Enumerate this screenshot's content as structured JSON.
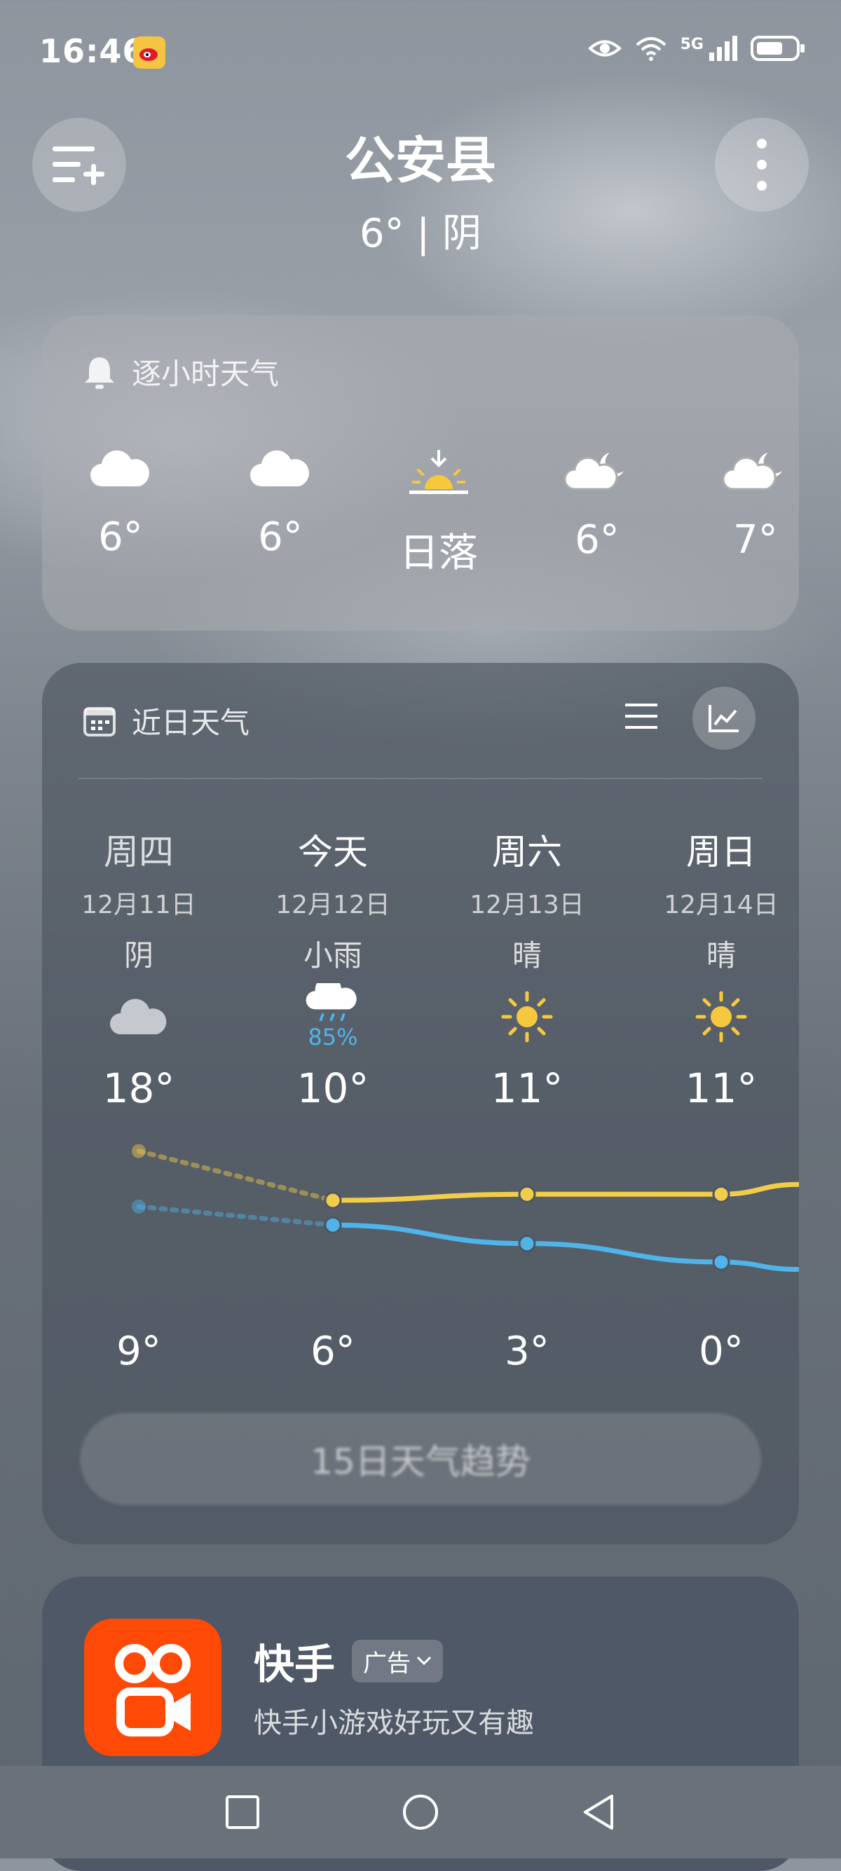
{
  "status": {
    "time": "16:46",
    "network": "5G"
  },
  "header": {
    "city": "公安县",
    "current": "6° | 阴"
  },
  "hourly": {
    "title": "逐小时天气",
    "items": [
      {
        "icon": "cloud-icon",
        "label": "6°"
      },
      {
        "icon": "cloud-icon",
        "label": "6°"
      },
      {
        "icon": "sunset-icon",
        "label": "日落"
      },
      {
        "icon": "cloud-moon-icon",
        "label": "6°"
      },
      {
        "icon": "cloud-moon-icon",
        "label": "7°"
      }
    ]
  },
  "daily": {
    "title": "近日天气",
    "days": [
      {
        "weekday": "周四",
        "date": "12月11日",
        "condition": "阴",
        "icon": "cloud-icon",
        "high": "18°",
        "low": "9°",
        "precip": ""
      },
      {
        "weekday": "今天",
        "date": "12月12日",
        "condition": "小雨",
        "icon": "rain-icon",
        "high": "10°",
        "low": "6°",
        "precip": "85%"
      },
      {
        "weekday": "周六",
        "date": "12月13日",
        "condition": "晴",
        "icon": "sun-icon",
        "high": "11°",
        "low": "3°",
        "precip": ""
      },
      {
        "weekday": "周日",
        "date": "12月14日",
        "condition": "晴",
        "icon": "sun-icon",
        "high": "11°",
        "low": "0°",
        "precip": ""
      }
    ],
    "high_values": [
      18,
      10,
      11,
      11
    ],
    "low_values": [
      9,
      6,
      3,
      0
    ],
    "high_color": "#f2cd4a",
    "low_color": "#4fb4ea",
    "more_button": "15日天气趋势"
  },
  "ad": {
    "app_name": "快手",
    "badge": "广告",
    "desc": "快手小游戏好玩又有趣",
    "brand_color": "#ff4906"
  }
}
